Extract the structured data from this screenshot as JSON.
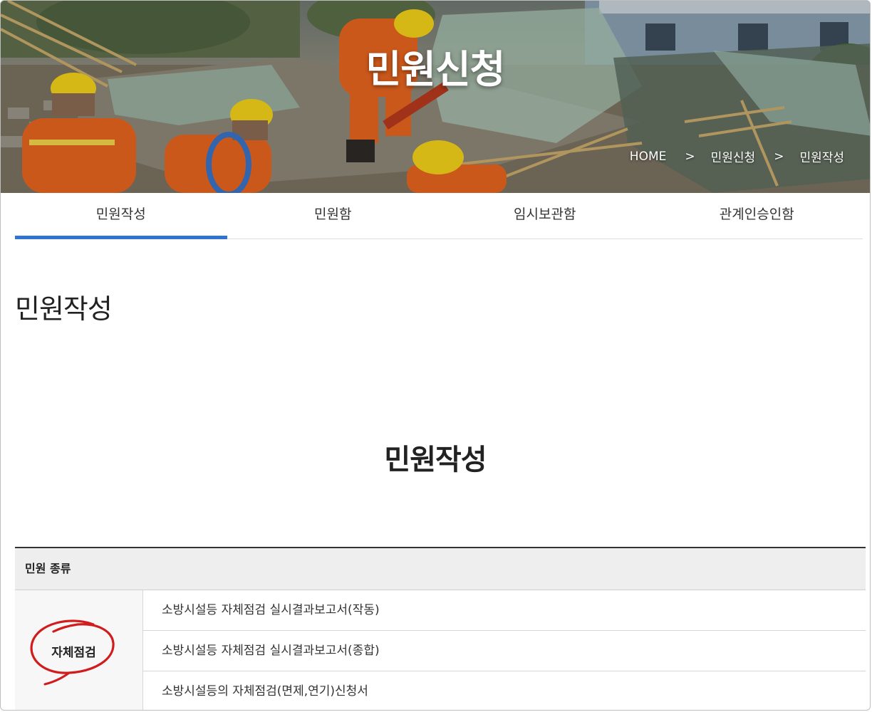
{
  "hero": {
    "title": "민원신청",
    "breadcrumb": [
      "HOME",
      "민원신청",
      "민원작성"
    ],
    "separator": ">"
  },
  "tabs": [
    {
      "label": "민원작성",
      "active": true
    },
    {
      "label": "민원함",
      "active": false
    },
    {
      "label": "임시보관함",
      "active": false
    },
    {
      "label": "관계인승인함",
      "active": false
    }
  ],
  "page_title": "민원작성",
  "form_title": "민원작성",
  "complaint_types": {
    "header": "민원 종류",
    "category": "자체점검",
    "items": [
      "소방시설등 자체점검 실시결과보고서(작동)",
      "소방시설등 자체점검 실시결과보고서(종합)",
      "소방시설등의 자체점검(면제,연기)신청서"
    ]
  },
  "colors": {
    "tab_active_underline": "#2f74d0",
    "circle_annotation": "#d01c1c",
    "rescue_uniform": "#e8651f",
    "helmet": "#f3d21a"
  }
}
